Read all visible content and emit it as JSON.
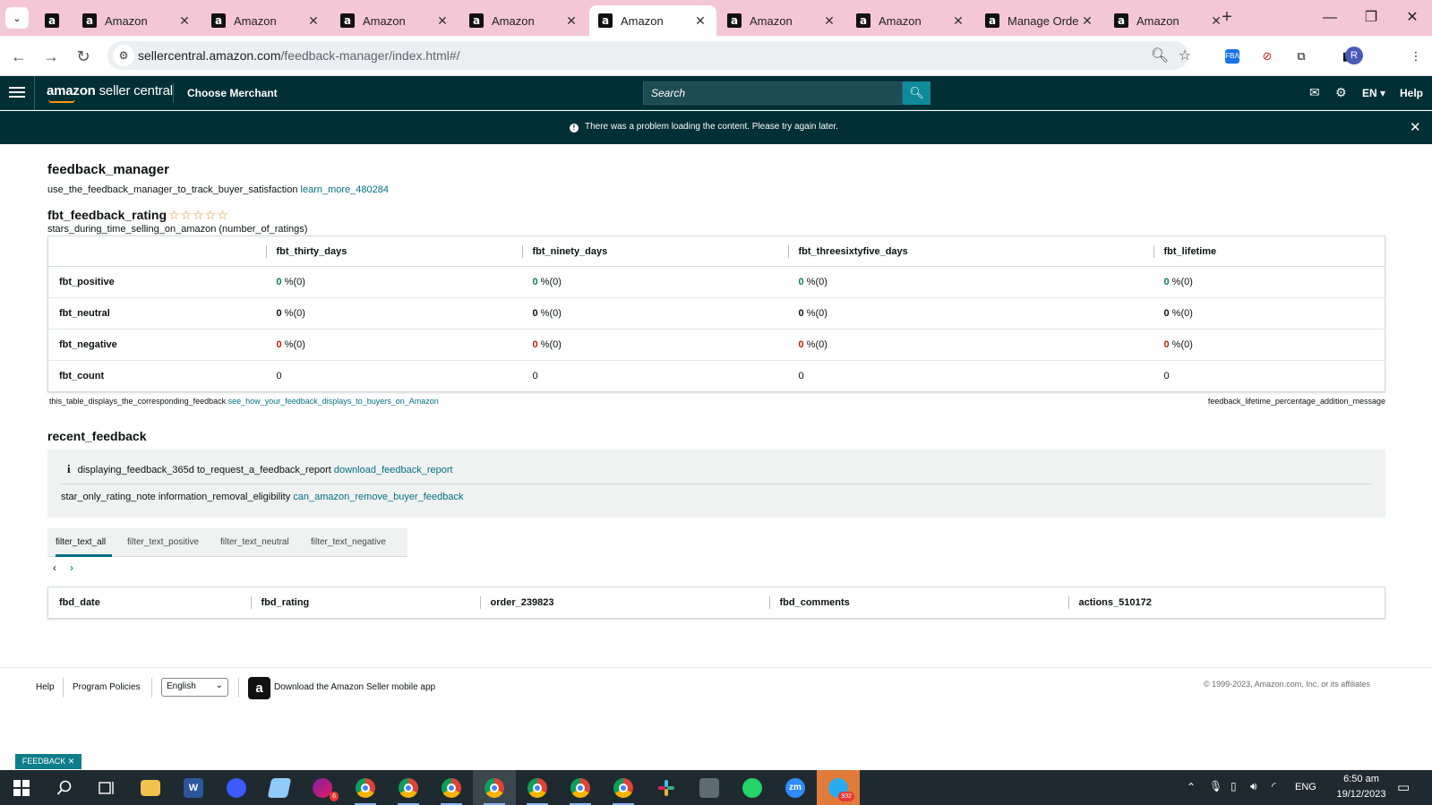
{
  "browser": {
    "tabs": [
      {
        "label": ""
      },
      {
        "label": "Amazon"
      },
      {
        "label": "Amazon"
      },
      {
        "label": "Amazon"
      },
      {
        "label": "Amazon"
      },
      {
        "label": "Amazon"
      },
      {
        "label": "Amazon"
      },
      {
        "label": "Amazon"
      },
      {
        "label": "Manage Orde"
      },
      {
        "label": "Amazon"
      }
    ],
    "url_host": "sellercentral.amazon.com",
    "url_path": "/feedback-manager/index.html#/"
  },
  "header": {
    "logo_bold": "amazon",
    "logo_rest": " seller central",
    "merchant": "Choose Merchant",
    "search_placeholder": "Search",
    "language": "EN ▾",
    "help": "Help"
  },
  "alert": {
    "message": "There was a problem loading the content. Please try again later."
  },
  "page": {
    "title": "feedback_manager",
    "subtitle": "use_the_feedback_manager_to_track_buyer_satisfaction",
    "learn_more": "learn_more_480284",
    "rating_title": "fbt_feedback_rating",
    "stars": "☆☆☆☆☆",
    "rating_sub": "stars_during_time_selling_on_amazon (number_of_ratings)"
  },
  "rating_table": {
    "columns": [
      "fbt_thirty_days",
      "fbt_ninety_days",
      "fbt_threesixtyfive_days",
      "fbt_lifetime"
    ],
    "rows": [
      {
        "label": "fbt_positive",
        "cells": [
          {
            "num": "0",
            "pct": " %(0)"
          },
          {
            "num": "0",
            "pct": " %(0)"
          },
          {
            "num": "0",
            "pct": " %(0)"
          },
          {
            "num": "0",
            "pct": " %(0)"
          }
        ]
      },
      {
        "label": "fbt_neutral",
        "cells": [
          {
            "num": "0",
            "pct": " %(0)"
          },
          {
            "num": "0",
            "pct": " %(0)"
          },
          {
            "num": "0",
            "pct": " %(0)"
          },
          {
            "num": "0",
            "pct": " %(0)"
          }
        ]
      },
      {
        "label": "fbt_negative",
        "cells": [
          {
            "num": "0",
            "pct": " %(0)"
          },
          {
            "num": "0",
            "pct": " %(0)"
          },
          {
            "num": "0",
            "pct": " %(0)"
          },
          {
            "num": "0",
            "pct": " %(0)"
          }
        ]
      },
      {
        "label": "fbt_count",
        "cells": [
          {
            "num": "0"
          },
          {
            "num": "0"
          },
          {
            "num": "0"
          },
          {
            "num": "0"
          }
        ]
      }
    ],
    "footnote": "this_table_displays_the_corresponding_feedback",
    "footnote_link": "see_how_your_feedback_displays_to_buyers_on_Amazon",
    "footnote_right": "feedback_lifetime_percentage_addition_message"
  },
  "recent": {
    "title": "recent_feedback",
    "info_icon": "i",
    "line1": "displaying_feedback_365d to_request_a_feedback_report",
    "line1_link": "download_feedback_report",
    "line2": "star_only_rating_note information_removal_eligibility",
    "line2_link": "can_amazon_remove_buyer_feedback",
    "filters": [
      "filter_text_all",
      "filter_text_positive",
      "filter_text_neutral",
      "filter_text_negative"
    ],
    "pager_prev": "‹",
    "pager_next": "›",
    "columns": [
      "fbd_date",
      "fbd_rating",
      "order_239823",
      "fbd_comments",
      "actions_510172"
    ]
  },
  "footer": {
    "help": "Help",
    "policies": "Program Policies",
    "language": "English",
    "app_text": "Download the Amazon Seller mobile app",
    "copyright": "© 1999-2023, Amazon.com, Inc. or its affiliates"
  },
  "feedback_button": "FEEDBACK ✕",
  "taskbar": {
    "badge_6": "6",
    "badge_932": "932",
    "lang": "ENG",
    "time": "6:50 am",
    "date": "19/12/2023",
    "zoom_label": "zm",
    "word_label": "W"
  },
  "colors": {
    "header_bg": "#002f36",
    "link": "#007185",
    "positive": "#067d62",
    "negative": "#b12704",
    "tabstrip": "#f4c7d6"
  }
}
